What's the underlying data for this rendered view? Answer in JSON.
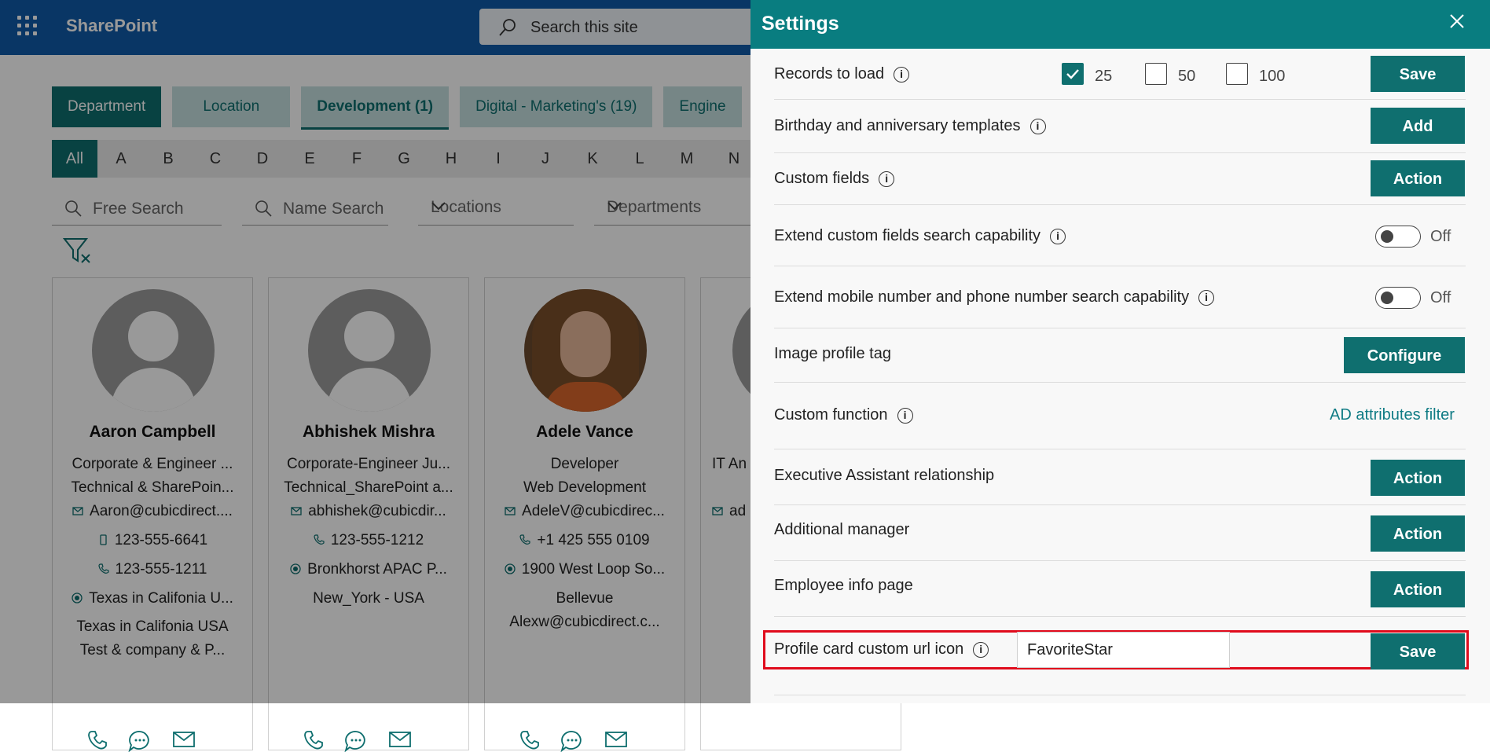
{
  "app": {
    "brand": "SharePoint",
    "search_placeholder": "Search this site",
    "tabs": [
      "Department",
      "Location",
      "Development (1)",
      "Digital - Marketing's (19)",
      "Engine"
    ],
    "alphabet": [
      "All",
      "A",
      "B",
      "C",
      "D",
      "E",
      "F",
      "G",
      "H",
      "I",
      "J",
      "K",
      "L",
      "M",
      "N"
    ],
    "filters": {
      "free_search": "Free Search",
      "name_search": "Name Search",
      "locations": "Locations",
      "departments": "Departments"
    },
    "cards": [
      {
        "name": "Aaron Campbell",
        "lines": [
          "Corporate & Engineer ...",
          "Technical & SharePoin..."
        ],
        "email": "Aaron@cubicdirect....",
        "mobile": "123-555-6641",
        "phone": "123-555-1211",
        "location": "Texas in Califonia U...",
        "extra": [
          "Texas in Califonia USA",
          "Test & company & P..."
        ]
      },
      {
        "name": "Abhishek Mishra",
        "lines": [
          "Corporate-Engineer Ju...",
          "Technical_SharePoint a..."
        ],
        "email": "abhishek@cubicdir...",
        "phone": "123-555-1212",
        "location": "Bronkhorst APAC P...",
        "extra": [
          "New_York - USA"
        ]
      },
      {
        "name": "Adele Vance",
        "lines": [
          "Developer",
          "Web Development"
        ],
        "email": "AdeleV@cubicdirec...",
        "phone": "+1 425 555 0109",
        "location": "1900 West Loop So...",
        "extra": [
          "Bellevue",
          "Alexw@cubicdirect.c..."
        ]
      },
      {
        "name": "",
        "lines": [
          "IT An"
        ],
        "email": "ad"
      }
    ]
  },
  "settings": {
    "title": "Settings",
    "records_label": "Records to load",
    "records_options": [
      {
        "value": "25",
        "checked": true
      },
      {
        "value": "50",
        "checked": false
      },
      {
        "value": "100",
        "checked": false
      }
    ],
    "records_button": "Save",
    "birthday_label": "Birthday and anniversary templates",
    "birthday_button": "Add",
    "custom_fields_label": "Custom fields",
    "custom_fields_button": "Action",
    "extend_custom_label": "Extend custom fields search capability",
    "extend_custom_state": "Off",
    "extend_mobile_label": "Extend mobile number and phone number search capability",
    "extend_mobile_state": "Off",
    "image_tag_label": "Image profile tag",
    "image_tag_button": "Configure",
    "custom_function_label": "Custom function",
    "custom_function_link": "AD attributes filter",
    "exec_label": "Executive Assistant relationship",
    "exec_button": "Action",
    "addl_manager_label": "Additional manager",
    "addl_manager_button": "Action",
    "emp_info_label": "Employee info page",
    "emp_info_button": "Action",
    "profile_icon_label": "Profile card custom url icon",
    "profile_icon_value": "FavoriteStar",
    "profile_icon_button": "Save",
    "accent_color": "#097d80",
    "highlight_color": "#e00b1c"
  }
}
